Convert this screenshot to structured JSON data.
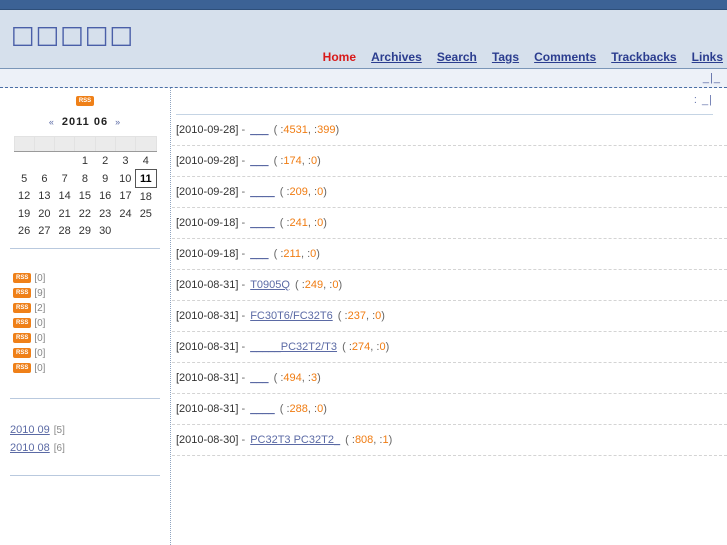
{
  "site": {
    "title": "□□□□□",
    "nav": [
      {
        "label": "Home",
        "active": true
      },
      {
        "label": "Archives",
        "active": false
      },
      {
        "label": "Search",
        "active": false
      },
      {
        "label": "Tags",
        "active": false
      },
      {
        "label": "Comments",
        "active": false
      },
      {
        "label": "Trackbacks",
        "active": false
      },
      {
        "label": "Links",
        "active": false
      }
    ],
    "breadcrumb": "_|_"
  },
  "main": {
    "breadcrumb": ": _|"
  },
  "sidebar": {
    "rss_badge": "RSS",
    "calendar": {
      "prev_arrow": "«",
      "next_arrow": "»",
      "year": "2011",
      "month": "06",
      "title": "2011  06",
      "weekday_headers": [
        "",
        "",
        "",
        "",
        "",
        "",
        ""
      ],
      "weeks": [
        [
          "",
          "",
          "",
          "1",
          "2",
          "3",
          "4"
        ],
        [
          "5",
          "6",
          "7",
          "8",
          "9",
          "10",
          "11"
        ],
        [
          "12",
          "13",
          "14",
          "15",
          "16",
          "17",
          "18"
        ],
        [
          "19",
          "20",
          "21",
          "22",
          "23",
          "24",
          "25"
        ],
        [
          "26",
          "27",
          "28",
          "29",
          "30",
          "",
          ""
        ]
      ],
      "today": "11"
    },
    "categories": [
      {
        "label": "",
        "rss": "RSS",
        "count": "[0]"
      },
      {
        "label": "",
        "rss": "RSS",
        "count": "[9]"
      },
      {
        "label": "",
        "rss": "RSS",
        "count": "[2]"
      },
      {
        "label": "",
        "rss": "RSS",
        "count": "[0]"
      },
      {
        "label": "",
        "rss": "RSS",
        "count": "[0]"
      },
      {
        "label": "",
        "rss": "RSS",
        "count": "[0]"
      },
      {
        "label": "",
        "rss": "RSS",
        "count": "[0]"
      }
    ],
    "archives": [
      {
        "label": "2010 09",
        "count": "[5]"
      },
      {
        "label": "2010 08",
        "count": "[6]"
      }
    ]
  },
  "posts": [
    {
      "date": "[2010-09-28]",
      "dash": "-",
      "title": "___",
      "open": "(",
      "views_label": ":",
      "views": "4531",
      "comma": ",",
      "comments_label": ":",
      "comments": "399",
      "close": ")"
    },
    {
      "date": "[2010-09-28]",
      "dash": "-",
      "title": "___",
      "open": "(",
      "views_label": ":",
      "views": "174",
      "comma": ",",
      "comments_label": ":",
      "comments": "0",
      "close": ")"
    },
    {
      "date": "[2010-09-28]",
      "dash": "-",
      "title": "____",
      "open": "(",
      "views_label": ":",
      "views": "209",
      "comma": ",",
      "comments_label": ":",
      "comments": "0",
      "close": ")"
    },
    {
      "date": "[2010-09-18]",
      "dash": "-",
      "title": "____",
      "open": "(",
      "views_label": ":",
      "views": "241",
      "comma": ",",
      "comments_label": ":",
      "comments": "0",
      "close": ")"
    },
    {
      "date": "[2010-09-18]",
      "dash": "-",
      "title": "___",
      "open": "(",
      "views_label": ":",
      "views": "211",
      "comma": ",",
      "comments_label": ":",
      "comments": "0",
      "close": ")"
    },
    {
      "date": "[2010-08-31]",
      "dash": "-",
      "title": "T0905Q",
      "open": "(",
      "views_label": ":",
      "views": "249",
      "comma": ",",
      "comments_label": ":",
      "comments": "0",
      "close": ")"
    },
    {
      "date": "[2010-08-31]",
      "dash": "-",
      "title": "FC30T6/FC32T6",
      "open": "(",
      "views_label": ":",
      "views": "237",
      "comma": ",",
      "comments_label": ":",
      "comments": "0",
      "close": ")"
    },
    {
      "date": "[2010-08-31]",
      "dash": "-",
      "title": "_____PC32T2/T3",
      "open": "(",
      "views_label": ":",
      "views": "274",
      "comma": ",",
      "comments_label": ":",
      "comments": "0",
      "close": ")"
    },
    {
      "date": "[2010-08-31]",
      "dash": "-",
      "title": "___",
      "open": "(",
      "views_label": ":",
      "views": "494",
      "comma": ",",
      "comments_label": ":",
      "comments": "3",
      "close": ")"
    },
    {
      "date": "[2010-08-31]",
      "dash": "-",
      "title": "____",
      "open": "(",
      "views_label": ":",
      "views": "288",
      "comma": ",",
      "comments_label": ":",
      "comments": "0",
      "close": ")"
    },
    {
      "date": "[2010-08-30]",
      "dash": "-",
      "title": "PC32T3 PC32T2_",
      "open": "(",
      "views_label": ":",
      "views": "808",
      "comma": ",",
      "comments_label": ":",
      "comments": "1",
      "close": ")"
    }
  ],
  "colors": {
    "topbar": "#3c6295",
    "header_bg": "#d6e0ec",
    "title": "#4a5fa8",
    "nav_link": "#2b3d8f",
    "nav_active": "#d81a1a",
    "link": "#5b6aa5",
    "number": "#f07c12",
    "rss_badge": "#ef8018"
  }
}
